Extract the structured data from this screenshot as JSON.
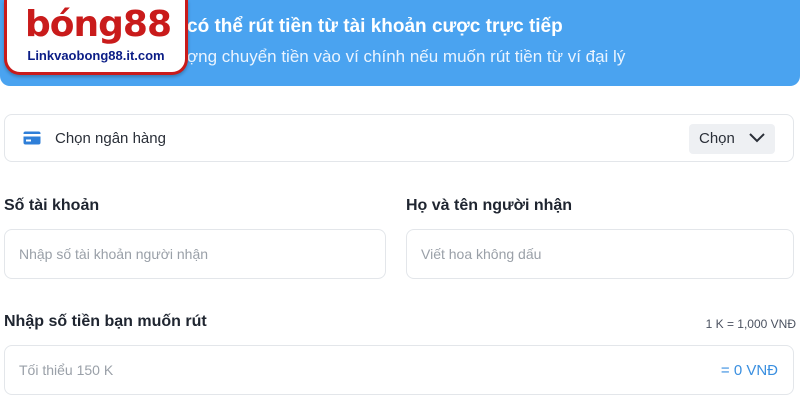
{
  "banner": {
    "line1": "có thể rút tiền từ tài khoản cược trực tiếp",
    "line2": "ợng chuyển tiền vào ví chính nếu muốn rút tiền từ ví đại lý",
    "color": "#4aa3f0"
  },
  "logo": {
    "wordmark": "bóng88",
    "url": "Linkvaobong88.it.com"
  },
  "bank": {
    "label": "Chọn ngân hàng",
    "icon": "bank-card-icon",
    "button_label": "Chọn",
    "button_icon": "chevron-down-icon"
  },
  "account_number": {
    "label": "Số tài khoản",
    "placeholder": "Nhập số tài khoản người nhận"
  },
  "recipient_name": {
    "label": "Họ và tên người nhận",
    "placeholder": "Viết hoa không dấu"
  },
  "amount": {
    "label": "Nhập số tiền bạn muốn rút",
    "rate": "1 K = 1,000 VNĐ",
    "placeholder": "Tối thiểu 150 K",
    "converted": "= 0 VNĐ",
    "accent": "#3a8fe0"
  }
}
